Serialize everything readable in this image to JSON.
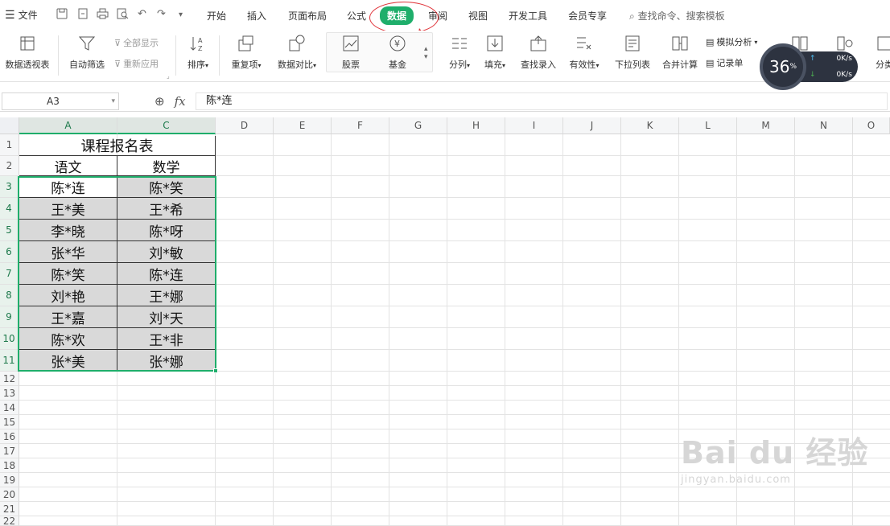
{
  "menubar": {
    "file_label": "文件",
    "tabs": [
      {
        "label": "开始",
        "active": false
      },
      {
        "label": "插入",
        "active": false
      },
      {
        "label": "页面布局",
        "active": false
      },
      {
        "label": "公式",
        "active": false
      },
      {
        "label": "数据",
        "active": true
      },
      {
        "label": "审阅",
        "active": false
      },
      {
        "label": "视图",
        "active": false
      },
      {
        "label": "开发工具",
        "active": false
      },
      {
        "label": "会员专享",
        "active": false
      }
    ],
    "search_placeholder": "查找命令、搜索模板",
    "accent_color": "#1fae6b",
    "annotation_color": "#e0343a"
  },
  "ribbon": {
    "pivot": "数据透视表",
    "autofilter": "自动筛选",
    "show_all": "全部显示",
    "reapply": "重新应用",
    "sort": "排序",
    "duplicates": "重复项",
    "compare": "数据对比",
    "stocks": "股票",
    "fund": "基金",
    "split": "分列",
    "fill": "填充",
    "lookup_entry": "查找录入",
    "validity": "有效性",
    "dropdown_list": "下拉列表",
    "consolidate": "合并计算",
    "what_if": "模拟分析",
    "record_sheet": "记录单",
    "partial_right": "分类"
  },
  "netwidget": {
    "percent": "36",
    "percent_sign": "%",
    "up": "0K/s",
    "down": "0K/s"
  },
  "formulabar": {
    "cell_ref": "A3",
    "fx": "fx",
    "value": "陈*连"
  },
  "grid": {
    "columns": [
      "A",
      "C",
      "D",
      "E",
      "F",
      "G",
      "H",
      "I",
      "J",
      "K",
      "L",
      "M",
      "N",
      "O"
    ],
    "rows": [
      "1",
      "2",
      "3",
      "4",
      "5",
      "6",
      "7",
      "8",
      "9",
      "10",
      "11",
      "12",
      "13",
      "14",
      "15",
      "16",
      "17",
      "18",
      "19",
      "20",
      "21",
      "22"
    ],
    "title": "课程报名表",
    "headers": [
      "语文",
      "数学"
    ],
    "data": [
      [
        "陈*连",
        "陈*笑"
      ],
      [
        "王*美",
        "王*希"
      ],
      [
        "李*晓",
        "陈*呀"
      ],
      [
        "张*华",
        "刘*敏"
      ],
      [
        "陈*笑",
        "陈*连"
      ],
      [
        "刘*艳",
        "王*娜"
      ],
      [
        "王*嘉",
        "刘*天"
      ],
      [
        "陈*欢",
        "王*非"
      ],
      [
        "张*美",
        "张*娜"
      ]
    ]
  },
  "watermark": {
    "main": "Bai du 经验",
    "sub": "jingyan.baidu.com"
  }
}
